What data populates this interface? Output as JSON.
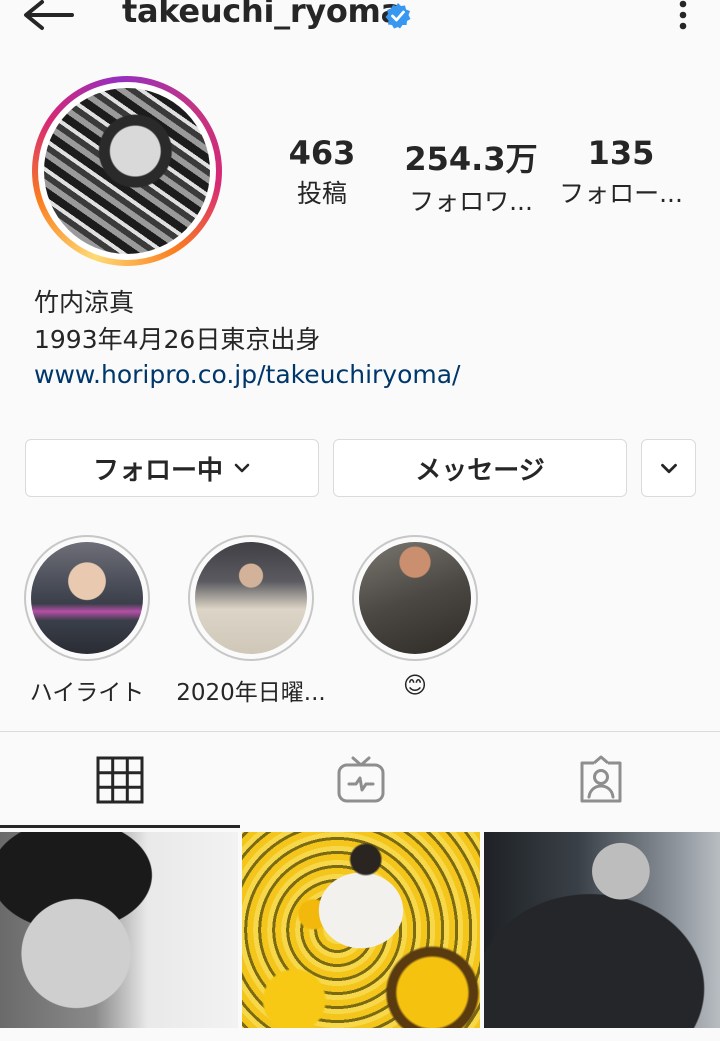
{
  "header": {
    "username": "takeuchi_ryoma",
    "icons": {
      "back": "arrow-left-icon",
      "verified": "verified-badge-icon",
      "more": "more-vertical-icon"
    },
    "verified_color": "#3897f0"
  },
  "profile": {
    "stats": [
      {
        "value": "463",
        "label": "投稿"
      },
      {
        "value": "254.3万",
        "label": "フォロワ..."
      },
      {
        "value": "135",
        "label": "フォロー..."
      }
    ],
    "name": "竹内涼真",
    "bio_line": "1993年4月26日東京出身",
    "website": "www.horipro.co.jp/takeuchiryoma/"
  },
  "actions": {
    "follow_label": "フォロー中",
    "message_label": "メッセージ",
    "icons": {
      "follow_dropdown": "chevron-down-icon",
      "suggest": "chevron-down-icon"
    }
  },
  "highlights": [
    {
      "label": "ハイライト"
    },
    {
      "label": "2020年日曜..."
    },
    {
      "label": "😊"
    }
  ],
  "tabs": [
    {
      "name": "posts-grid",
      "icon": "grid-icon",
      "selected": true
    },
    {
      "name": "igtv",
      "icon": "igtv-icon",
      "selected": false
    },
    {
      "name": "tagged",
      "icon": "tagged-person-icon",
      "selected": false
    }
  ],
  "colors": {
    "link": "#00376b",
    "text": "#262626",
    "border": "#dbdbdb",
    "background": "#fafafa"
  }
}
